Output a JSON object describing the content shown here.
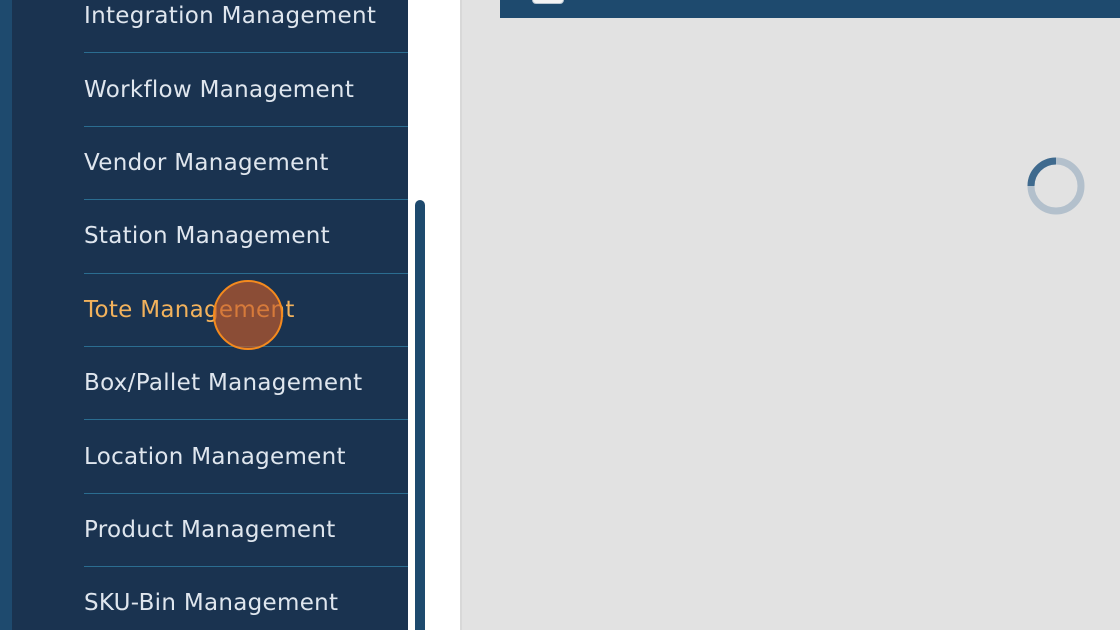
{
  "sidebar": {
    "items": [
      {
        "label": "Integration Management",
        "active": false
      },
      {
        "label": "Workflow Management",
        "active": false
      },
      {
        "label": "Vendor Management",
        "active": false
      },
      {
        "label": "Station Management",
        "active": false
      },
      {
        "label": "Tote Management",
        "active": true
      },
      {
        "label": "Box/Pallet Management",
        "active": false
      },
      {
        "label": "Location Management",
        "active": false
      },
      {
        "label": "Product Management",
        "active": false
      },
      {
        "label": "SKU-Bin Management",
        "active": false
      }
    ]
  },
  "main": {
    "loading": true,
    "spinner_icon": "loading-spinner-icon"
  },
  "colors": {
    "sidebar_bg": "#1a3350",
    "accent_blue": "#1e4a6e",
    "divider": "#2b6d90",
    "active_text": "#f2b25c",
    "menu_text": "#dfe6ee",
    "content_bg": "#e2e2e2",
    "click_indicator": "#f48a1e"
  }
}
